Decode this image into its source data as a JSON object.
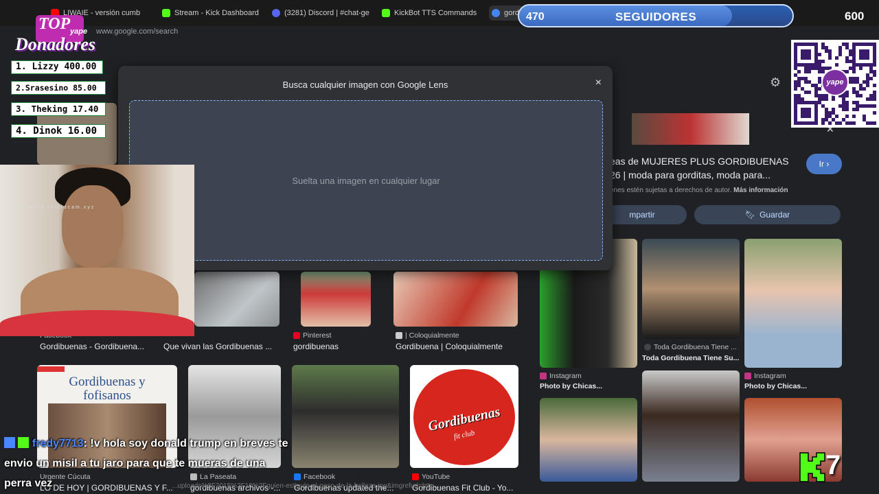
{
  "browser": {
    "tabs": [
      {
        "label": "LIWAIE - versión cumb",
        "color": "#ff0000"
      },
      {
        "label": "Stream - Kick Dashboard",
        "color": "#53fc18"
      },
      {
        "label": "(3281) Discord | #chat-ge",
        "color": "#5865f2"
      },
      {
        "label": "KickBot TTS Commands",
        "color": "#53fc18"
      },
      {
        "label": "gord",
        "color": "#4285f4"
      }
    ],
    "url": "www.google.com/search"
  },
  "lens_modal": {
    "title": "Busca cualquier imagen con Google Lens",
    "drop_text": "Suelta una imagen en cualquier lugar",
    "close_symbol": "×"
  },
  "results": {
    "row1": [
      {
        "source": "Facebook",
        "title": "Gordibuenas - Gordibuena..."
      },
      {
        "source": "",
        "title": "Que vivan las Gordibuenas ..."
      },
      {
        "source": "Pinterest",
        "title": "gordibuenas"
      },
      {
        "source": "| Coloquialmente",
        "title": "Gordibuena | Coloquialmente"
      }
    ],
    "row2": [
      {
        "source": "Urgente Cúcuta",
        "title": "LO DE HOY | GORDIBUENAS Y F...",
        "image_text_1": "Gordibuenas y",
        "image_text_2": "fofisanos"
      },
      {
        "source": "La Paseata",
        "title": "gordibuenas archivos -..."
      },
      {
        "source": "Facebook",
        "title": "Gordibuenas updated the..."
      },
      {
        "source": "YouTube",
        "title": "Gordibuenas Fit Club - Yo...",
        "image_text_1": "Gordibuenas",
        "image_text_2": "fit club"
      }
    ]
  },
  "right_panel": {
    "title_line1": "eas de MUJERES PLUS GORDIBUENAS",
    "title_line2": "26 | moda para gorditas, moda para...",
    "go_button": "Ir ›",
    "copyright": "enes estén sujetas a derechos de autor.",
    "more_info": "Más información",
    "share_button": "mpartir",
    "save_button": "Guardar",
    "related": [
      {
        "source": "",
        "title": ""
      },
      {
        "source": "Toda Gordibuena Tiene ...",
        "title": "Toda Gordibuena Tiene Su..."
      },
      {
        "source": "Instagram",
        "title": "Photo by Chicas..."
      },
      {
        "source": "Instagram",
        "title": "Photo by Chicas..."
      }
    ]
  },
  "overlay": {
    "followers_current": "470",
    "followers_label": "SEGUIDORES",
    "followers_goal": "600",
    "followers_progress": 0.78,
    "donors_title_top": "TOP",
    "donors_title_mid": "yape",
    "donors_title_bottom": "Donadores",
    "donors": [
      {
        "rank": "1.",
        "text": "Lizzy 400.00"
      },
      {
        "rank": "2.",
        "text": "Srasesino 85.00"
      },
      {
        "rank": "3.",
        "text": "Theking 17.40"
      },
      {
        "rank": "4.",
        "text": "Dinok 16.00"
      }
    ],
    "webcam_watermark": "twitch.tv/oldcam.xyz",
    "chat_user": "fredy7713",
    "chat_message": ": !v hola soy donald trump en breves te envio un misil a tu jaro para que te mueras de una perra vez",
    "qr_label": "yape",
    "kick_count": "7"
  },
  "status_url": "...uploads%2F2015%2F10%2Fquien-estipulo-el-peso-de-la-belleza.jpg&imgrefurl=http..."
}
